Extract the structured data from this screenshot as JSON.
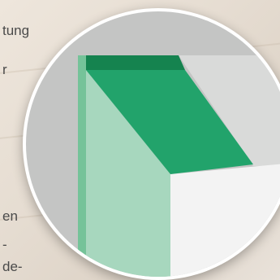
{
  "background_text": {
    "lines": [
      "tung",
      "r",
      "en",
      "-",
      "de-"
    ]
  },
  "magnifier": {
    "colors": {
      "wall": "#c4c5c4",
      "ceiling": "#d9dad9",
      "floor": "#f3f3f3",
      "awning": "#22a36b",
      "awning_dark": "#15834f",
      "pillar_light": "#a7d7be",
      "pillar_edge": "#75c399"
    }
  }
}
